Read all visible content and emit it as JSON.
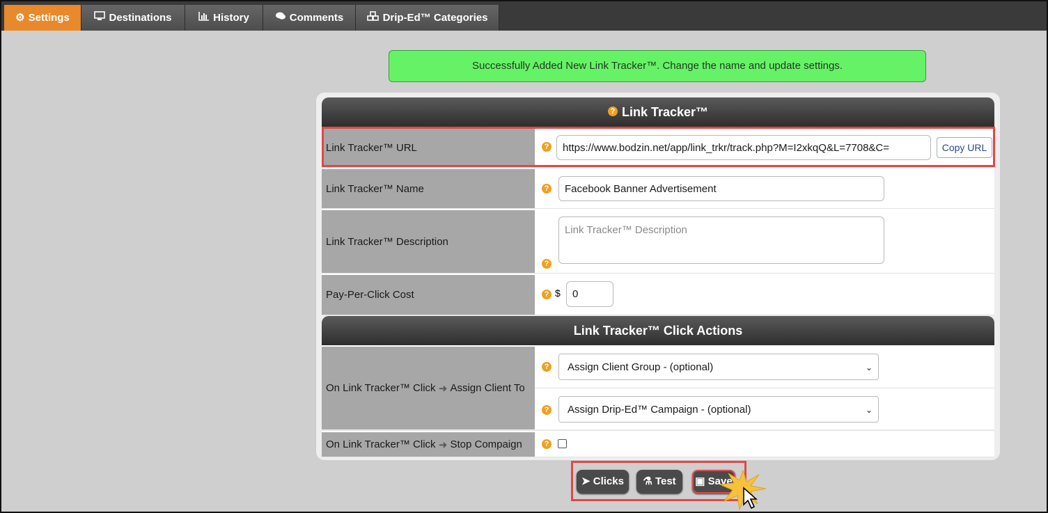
{
  "tabs": [
    {
      "label": "Settings",
      "icon": "gear-icon",
      "glyph": "⚙"
    },
    {
      "label": "Destinations",
      "icon": "monitor-icon",
      "glyph": "🖵"
    },
    {
      "label": "History",
      "icon": "bar-chart-icon",
      "glyph": "▮"
    },
    {
      "label": "Comments",
      "icon": "comments-icon",
      "glyph": "💬"
    },
    {
      "label": "Drip-Ed™ Categories",
      "icon": "cubes-icon",
      "glyph": "⚙"
    }
  ],
  "alert": {
    "message": "Successfully Added New Link Tracker™. Change the name and update settings."
  },
  "section1": {
    "title": "Link Tracker™",
    "help": "?"
  },
  "fields": {
    "url": {
      "label": "Link Tracker™ URL",
      "value": "https://www.bodzin.net/app/link_trkr/track.php?M=I2xkqQ&L=7708&C=",
      "copy_label": "Copy URL"
    },
    "name": {
      "label": "Link Tracker™ Name",
      "value": "Facebook Banner Advertisement"
    },
    "description": {
      "label": "Link Tracker™ Description",
      "placeholder": "Link Tracker™ Description"
    },
    "ppc": {
      "label": "Pay-Per-Click Cost",
      "currency": "$",
      "value": "0"
    }
  },
  "section2": {
    "title": "Link Tracker™ Click Actions"
  },
  "actions": {
    "assign": {
      "label": "On Link Tracker™ Click",
      "arrow": "⊕",
      "label_suffix": "Assign Client To",
      "group_select": "Assign Client Group - (optional)",
      "campaign_select": "Assign Drip-Ed™ Campaign - (optional)"
    },
    "stop": {
      "label": "On Link Tracker™ Click",
      "arrow": "⊕",
      "label_suffix": "Stop Compaign"
    }
  },
  "buttons": {
    "clicks": "Clicks",
    "test": "Test",
    "save": "Save"
  },
  "colors": {
    "active_tab": "#e8892c",
    "alert_bg": "#66f266",
    "highlight": "#e04848",
    "help_icon": "#f0a020"
  }
}
